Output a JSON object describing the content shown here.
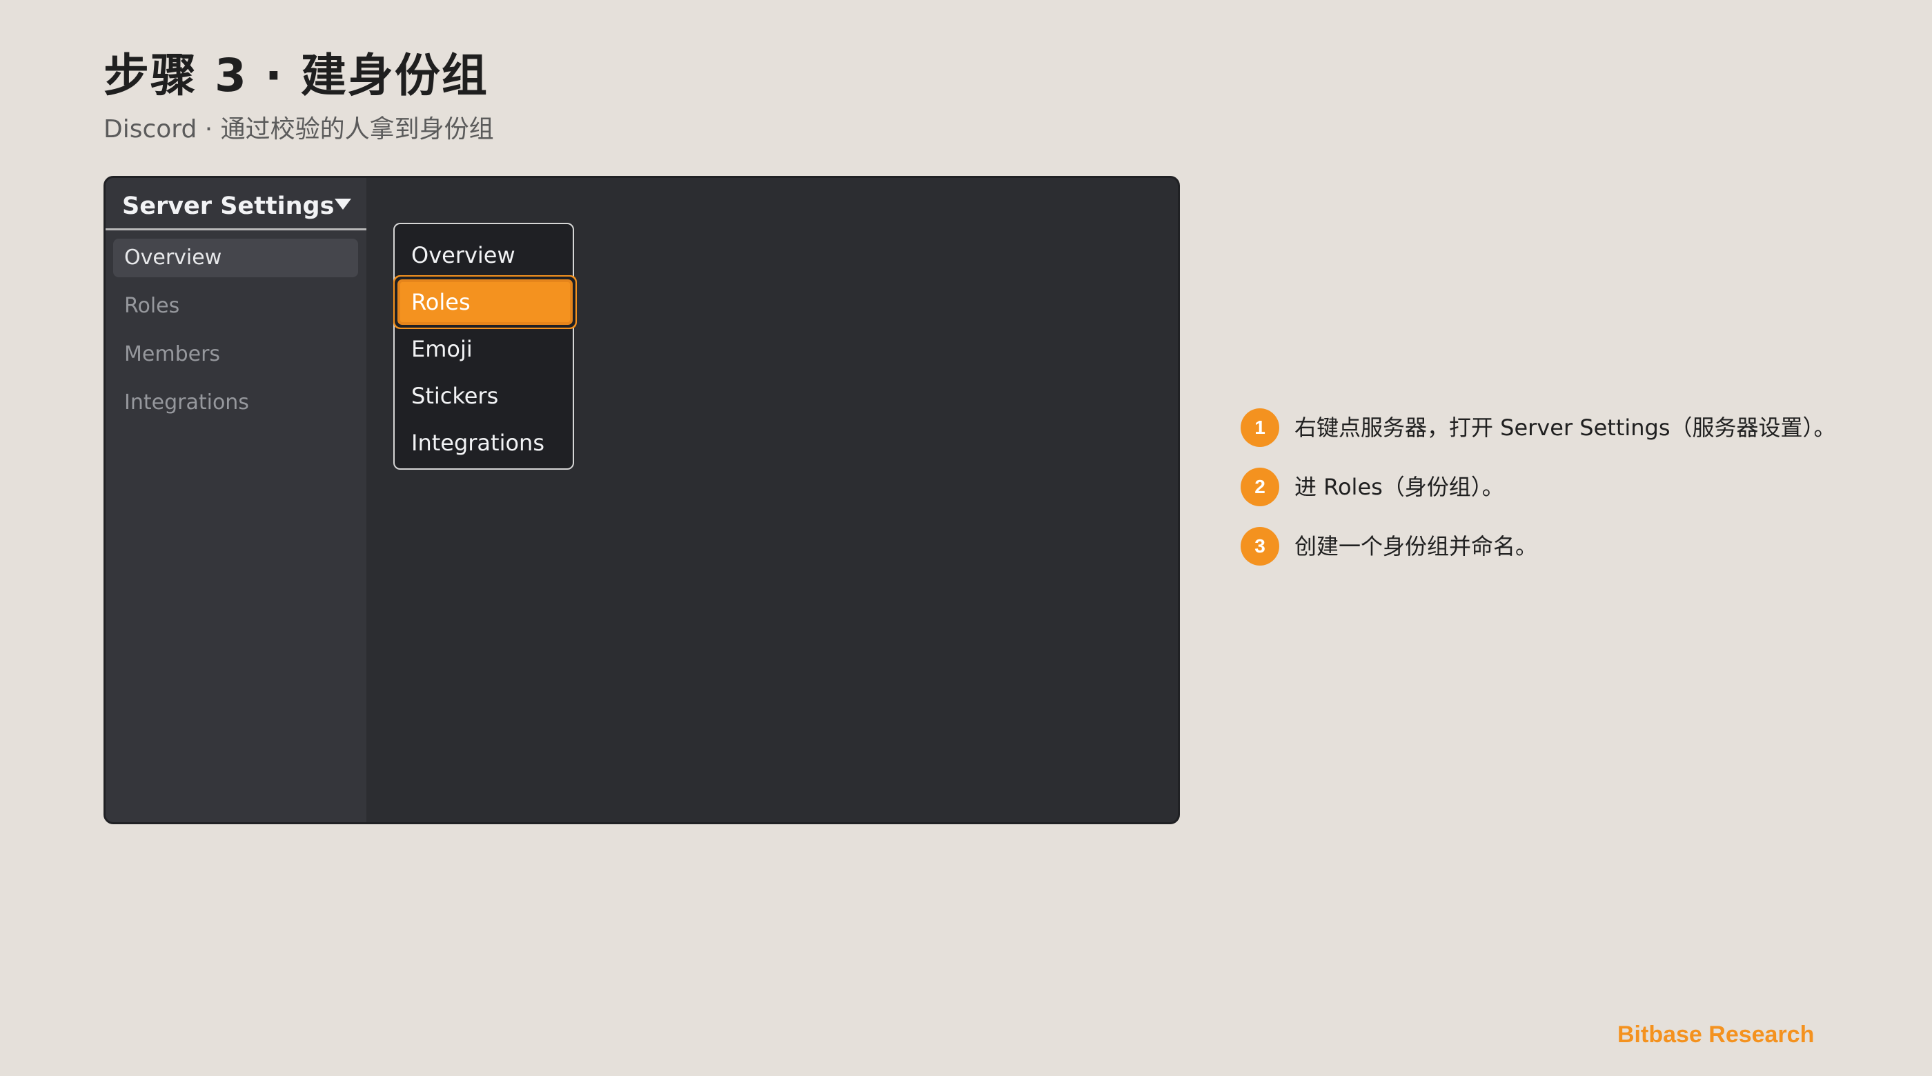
{
  "page": {
    "title": "步骤 3 · 建身份组",
    "subtitle": "Discord · 通过校验的人拿到身份组"
  },
  "sidebar": {
    "title": "Server Settings",
    "items": [
      {
        "label": "Overview",
        "active": true
      },
      {
        "label": "Roles"
      },
      {
        "label": "Members"
      },
      {
        "label": "Integrations"
      }
    ]
  },
  "context_menu": {
    "items": [
      {
        "label": "Overview"
      },
      {
        "label": "Roles",
        "highlighted": true
      },
      {
        "label": "Emoji"
      },
      {
        "label": "Stickers"
      },
      {
        "label": "Integrations"
      }
    ]
  },
  "steps": [
    {
      "number": "1",
      "text": "右键点服务器，打开 Server Settings（服务器设置）。"
    },
    {
      "number": "2",
      "text": "进 Roles（身份组）。"
    },
    {
      "number": "3",
      "text": "创建一个身份组并命名。"
    }
  ],
  "footer": {
    "brand": "Bitbase Research"
  },
  "colors": {
    "accent": "#f4921f",
    "background": "#e5e0da",
    "window": "#2c2d31",
    "sidebar": "#35363b"
  }
}
